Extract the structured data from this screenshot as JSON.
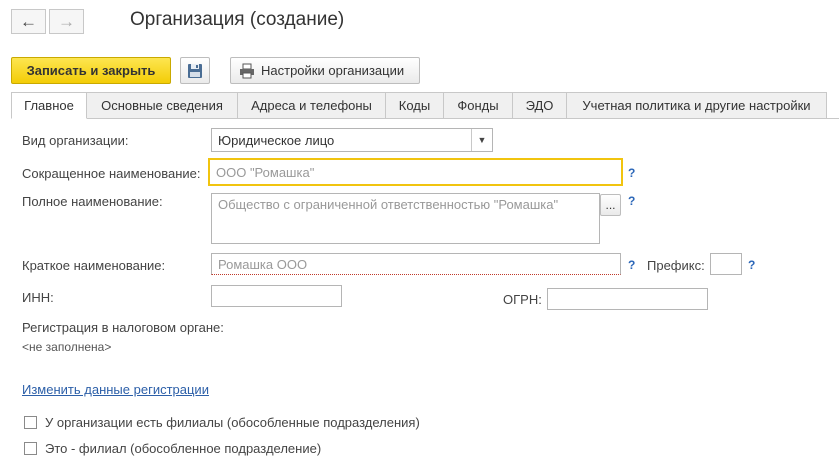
{
  "window": {
    "title": "Организация (создание)",
    "back_icon": "←",
    "forward_icon": "→"
  },
  "toolbar": {
    "save_close_label": "Записать и закрыть",
    "settings_label": "Настройки организации"
  },
  "tabs": [
    {
      "label": "Главное",
      "active": true
    },
    {
      "label": "Основные сведения"
    },
    {
      "label": "Адреса и телефоны"
    },
    {
      "label": "Коды"
    },
    {
      "label": "Фонды"
    },
    {
      "label": "ЭДО"
    },
    {
      "label": "Учетная политика и другие настройки"
    }
  ],
  "form": {
    "org_type_label": "Вид организации:",
    "org_type_value": "Юридическое лицо",
    "short_name_label": "Сокращенное наименование:",
    "short_name_placeholder": "ООО \"Ромашка\"",
    "full_name_label": "Полное наименование:",
    "full_name_placeholder": "Общество с ограниченной ответственностью \"Ромашка\"",
    "brief_name_label": "Краткое наименование:",
    "brief_name_placeholder": "Ромашка ООО",
    "prefix_label": "Префикс:",
    "inn_label": "ИНН:",
    "ogrn_label": "ОГРН:",
    "help_mark": "?",
    "ellipsis": "...",
    "tax_reg_label": "Регистрация в налоговом органе:",
    "tax_reg_value": "<не заполнена>",
    "change_reg_link": "Изменить данные регистрации",
    "has_branches_label": "У организации есть филиалы (обособленные подразделения)",
    "is_branch_label": "Это - филиал (обособленное подразделение)"
  },
  "colors": {
    "accent_yellow": "#f3cd07",
    "focus_border": "#f1c40f",
    "link": "#2c5fa8"
  }
}
